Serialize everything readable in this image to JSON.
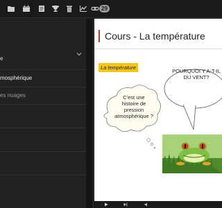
{
  "toolbar": {
    "icons": [
      "folder-icon",
      "calendar-icon",
      "document-icon",
      "trophy-icon",
      "trash-icon",
      "chart-icon",
      "link-icon"
    ],
    "badge": "29"
  },
  "sidebar": {
    "items": [
      {
        "label": "e"
      },
      {
        "label": "mosphérique"
      },
      {
        "label": "es nuages"
      },
      {
        "label": ""
      },
      {
        "label": ""
      },
      {
        "label": ""
      }
    ]
  },
  "content": {
    "title": "Cours - La température",
    "tag": "La température",
    "speech_bubble": "POURQUOI Y A-T-IL DU VENT?",
    "thought_bubble": "C'est une histoire de pression atmosphérique ?",
    "image": "frog-photo"
  },
  "colors": {
    "accent": "#c0392b",
    "tag_bg": "#f5c518",
    "sidebar_bg": "#222222",
    "toolbar_bg": "#1a1a1a"
  }
}
